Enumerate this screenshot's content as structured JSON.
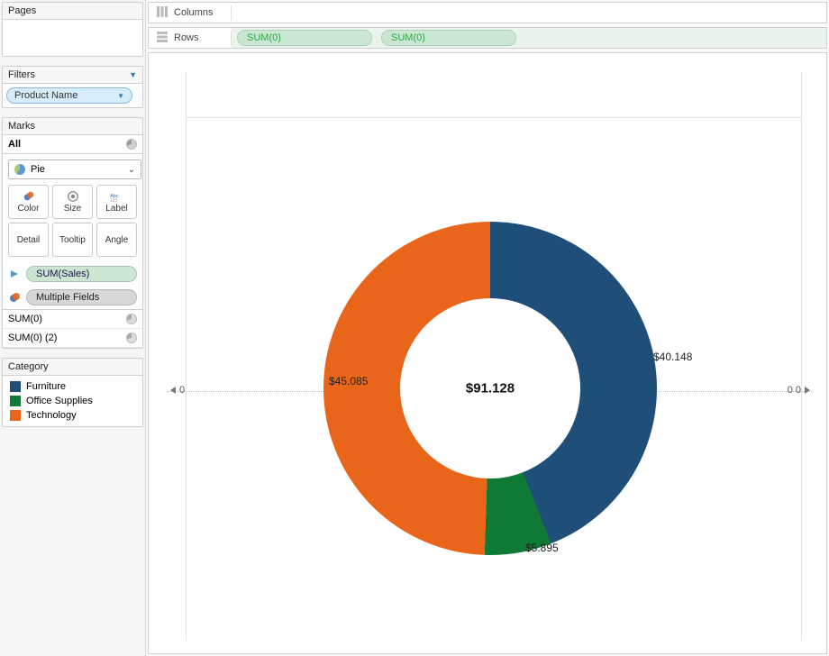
{
  "sidebar": {
    "pages": {
      "title": "Pages"
    },
    "filters": {
      "title": "Filters",
      "pill": "Product Name"
    },
    "marks": {
      "title": "Marks",
      "all_label": "All",
      "mark_type": "Pie",
      "cells": {
        "color": "Color",
        "size": "Size",
        "label": "Label",
        "detail": "Detail",
        "tooltip": "Tooltip",
        "angle": "Angle"
      },
      "pills": {
        "sum_sales": "SUM(Sales)",
        "multiple_fields": "Multiple Fields"
      },
      "sum_rows": [
        "SUM(0)",
        "SUM(0) (2)"
      ]
    },
    "category": {
      "title": "Category",
      "items": [
        {
          "label": "Furniture",
          "color": "#1f4e79"
        },
        {
          "label": "Office Supplies",
          "color": "#0e7a35"
        },
        {
          "label": "Technology",
          "color": "#e8651a"
        }
      ]
    }
  },
  "shelves": {
    "columns_label": "Columns",
    "rows_label": "Rows",
    "row_pills": [
      "SUM(0)",
      "SUM(0)"
    ]
  },
  "axis": {
    "left_tick": "0",
    "right_tick": "0 0"
  },
  "chart_data": {
    "type": "pie",
    "title": "",
    "center_label": "$91.128",
    "series": [
      {
        "name": "Furniture",
        "value": 40.148,
        "label": "$40.148",
        "color": "#1f4e79"
      },
      {
        "name": "Office Supplies",
        "value": 5.895,
        "label": "$5.895",
        "color": "#0e7a35"
      },
      {
        "name": "Technology",
        "value": 45.085,
        "label": "$45.085",
        "color": "#e8651a"
      }
    ],
    "total": 91.128,
    "donut": true
  }
}
